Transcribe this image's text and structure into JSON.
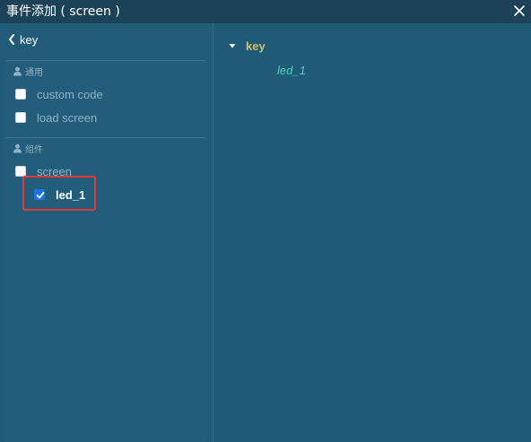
{
  "window": {
    "title": "事件添加 ( screen )"
  },
  "left_panel": {
    "back_label": "key",
    "sections": [
      {
        "header": "通用",
        "items": [
          {
            "label": "custom code",
            "checked": false
          },
          {
            "label": "load screen",
            "checked": false
          }
        ]
      },
      {
        "header": "组件",
        "items": [
          {
            "label": "screen",
            "checked": false
          },
          {
            "label": "led_1",
            "checked": true
          }
        ]
      }
    ]
  },
  "right_panel": {
    "tree_root": "key",
    "tree_child": "led_1"
  },
  "colors": {
    "background": "#1f5a77",
    "titlebar": "#1c4258",
    "tree_root_text": "#d2c16b",
    "tree_child_text": "#4fd1c5",
    "highlight_border": "#e53935",
    "checkbox_checked": "#1a73e8"
  }
}
